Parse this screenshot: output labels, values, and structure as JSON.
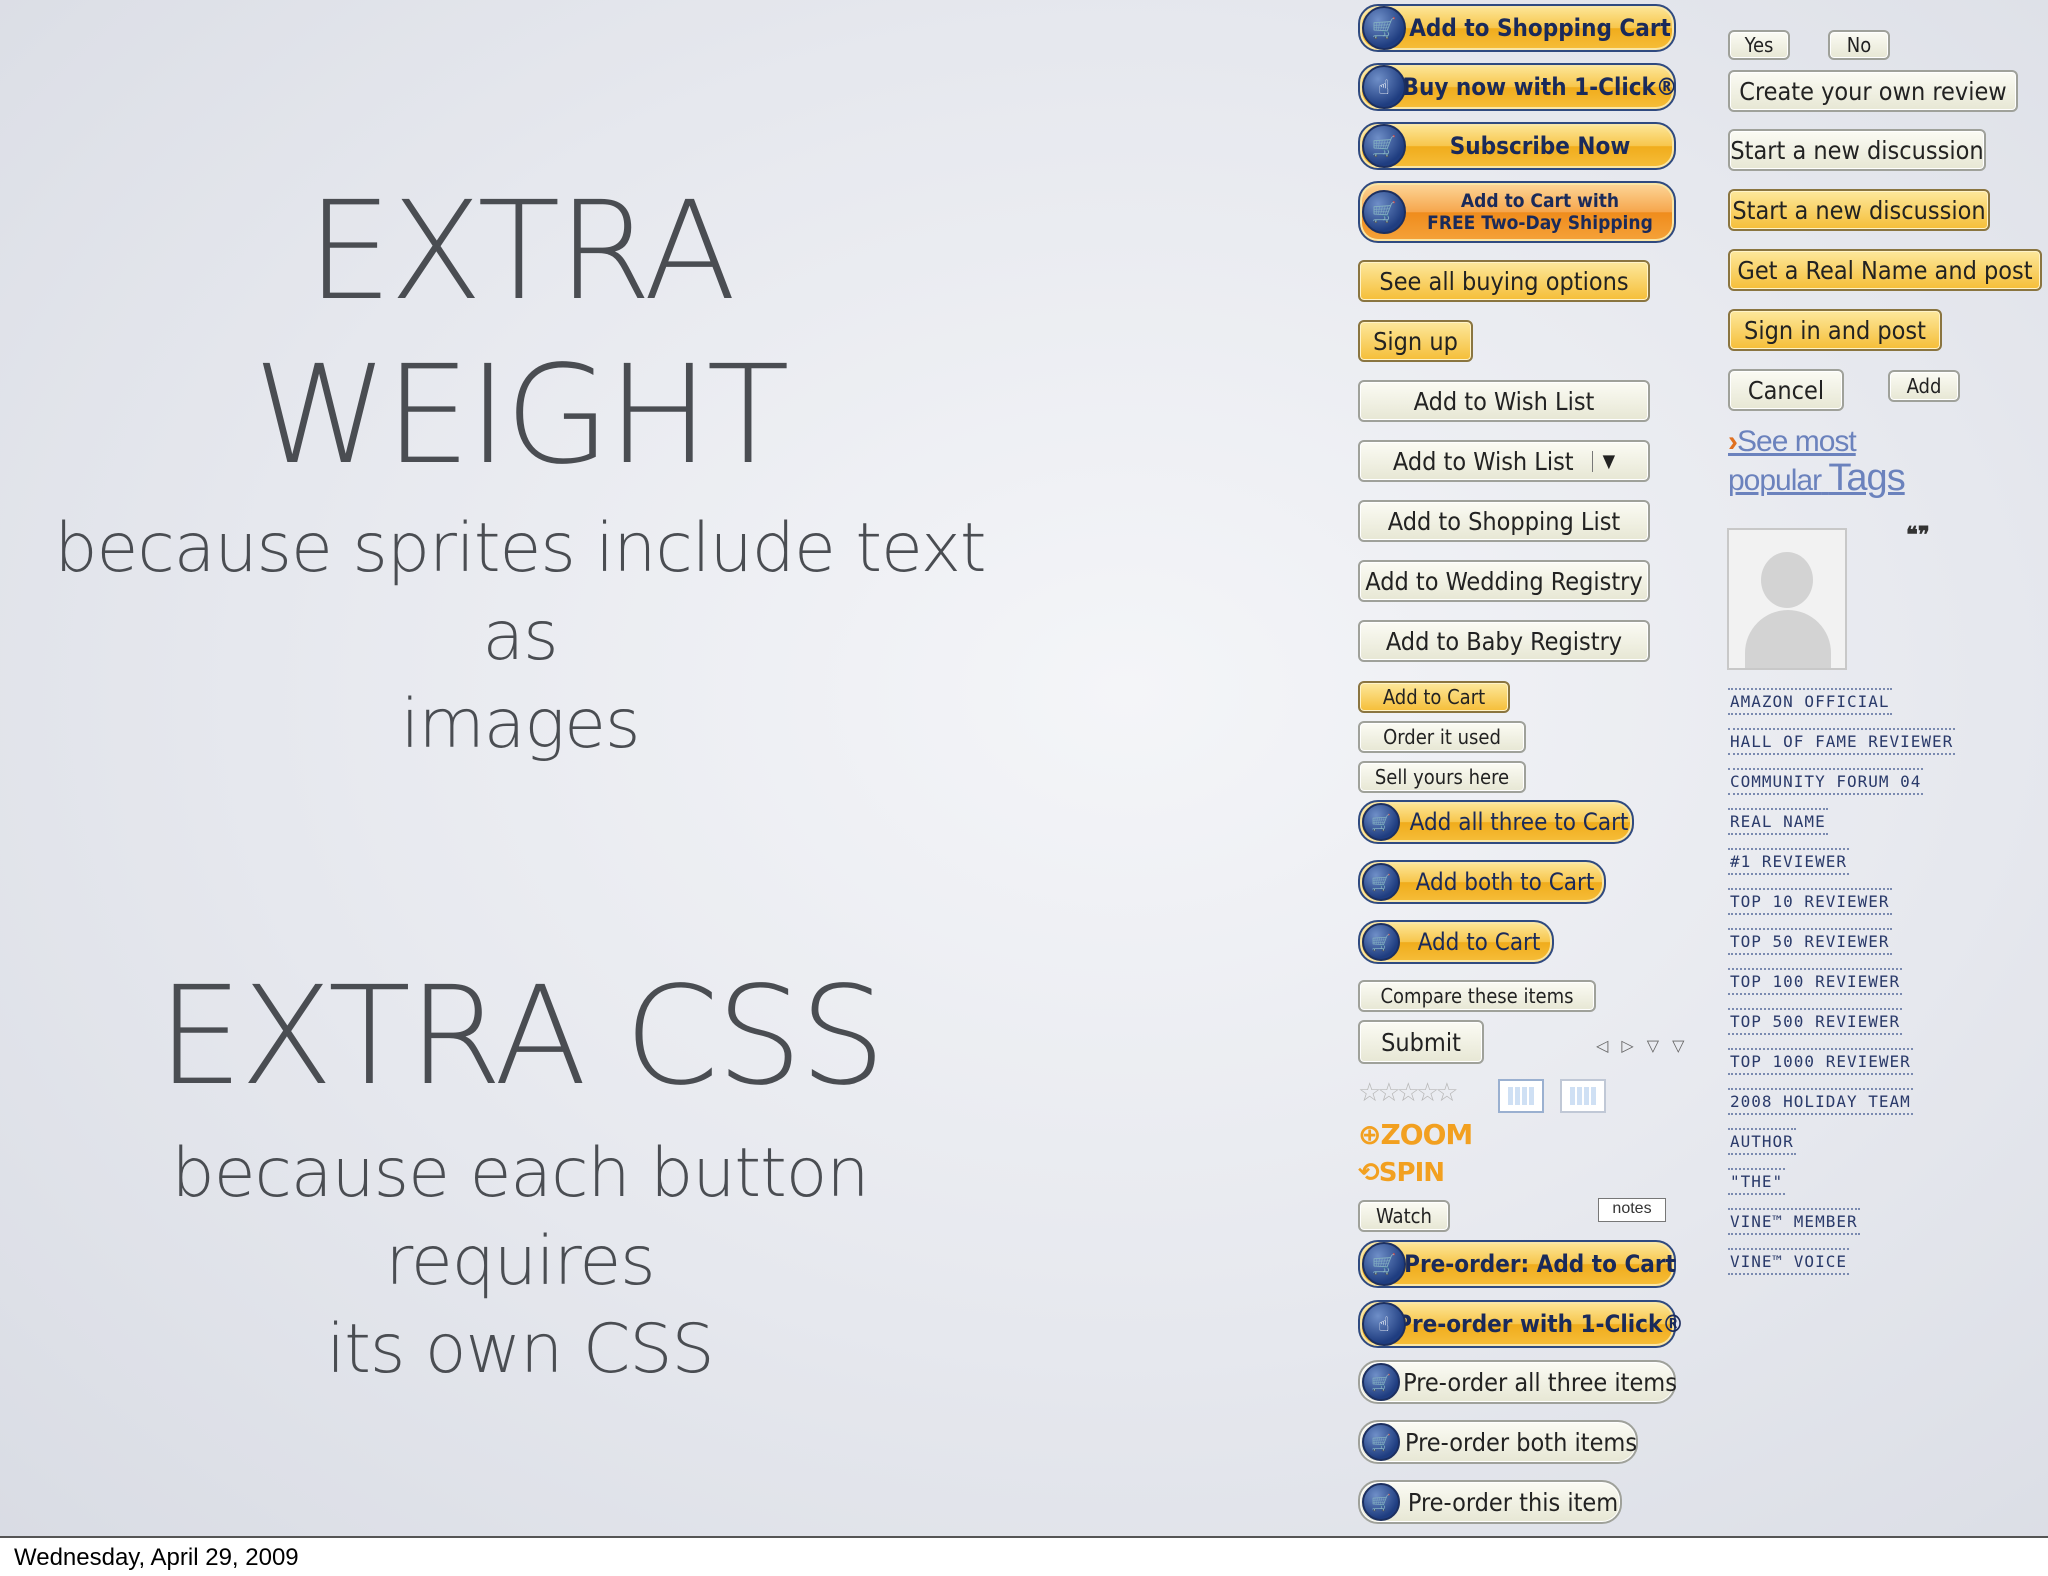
{
  "slide": {
    "heading1": [
      "EXTRA",
      "WEIGHT"
    ],
    "sub1": [
      "because sprites include text as",
      "images"
    ],
    "heading2": "EXTRA CSS",
    "sub2": [
      "because each button requires",
      "its own CSS"
    ]
  },
  "footer": {
    "date": "Wednesday, April 29, 2009"
  },
  "buttons_left": {
    "add_to_shopping_cart": "Add to Shopping Cart",
    "buy_now": "Buy now with 1-Click®",
    "subscribe_now": "Subscribe Now",
    "add_free_shipping": [
      "Add to Cart with",
      "FREE Two-Day Shipping"
    ],
    "see_all_buying": "See all buying options",
    "sign_up": "Sign up",
    "add_wish_list": "Add to Wish List",
    "add_wish_list_dd": "Add to Wish List",
    "add_shopping_list": "Add to Shopping List",
    "add_wedding_registry": "Add to Wedding Registry",
    "add_baby_registry": "Add to Baby Registry",
    "add_to_cart_small": "Add to Cart",
    "order_it_used": "Order it used",
    "sell_yours_here": "Sell yours here",
    "add_all_three": "Add all three to Cart",
    "add_both": "Add both to Cart",
    "add_to_cart": "Add to Cart",
    "compare_items": "Compare these items",
    "submit": "Submit",
    "zoom": "ZOOM",
    "spin": "SPIN",
    "watch": "Watch",
    "notes": "notes",
    "preorder_add": "Pre-order: Add to Cart",
    "preorder_1click": "Pre-order with 1-Click®",
    "preorder_all_three": "Pre-order all three items",
    "preorder_both": "Pre-order both items",
    "preorder_this": "Pre-order this item"
  },
  "buttons_right": {
    "yes": "Yes",
    "no": "No",
    "create_review": "Create your own review",
    "start_discussion_1": "Start a new discussion",
    "start_discussion_2": "Start a new discussion",
    "real_name_post": "Get a Real Name and post",
    "sign_in_post": "Sign in and post",
    "cancel": "Cancel",
    "add": "Add",
    "tags": [
      "See most",
      "popular",
      "Tags"
    ]
  },
  "badges": [
    "AMAZON OFFICIAL",
    "HALL OF FAME REVIEWER",
    "COMMUNITY FORUM 04",
    "REAL NAME",
    "#1 REVIEWER",
    "TOP 10 REVIEWER",
    "TOP 50 REVIEWER",
    "TOP 100 REVIEWER",
    "TOP 500 REVIEWER",
    "TOP 1000 REVIEWER",
    "2008 HOLIDAY TEAM",
    "AUTHOR",
    "\"THE\"",
    "VINE™ MEMBER",
    "VINE™ VOICE"
  ],
  "icons": {
    "cart": "shopping-cart-icon",
    "hand": "hand-pointer-icon",
    "star": "star-rating-icon",
    "calendar": "calendar-icon",
    "avatar": "avatar-placeholder-icon"
  },
  "colors": {
    "gold": "#f7c64c",
    "navy": "#2f4a80",
    "text": "#4a4d52"
  }
}
